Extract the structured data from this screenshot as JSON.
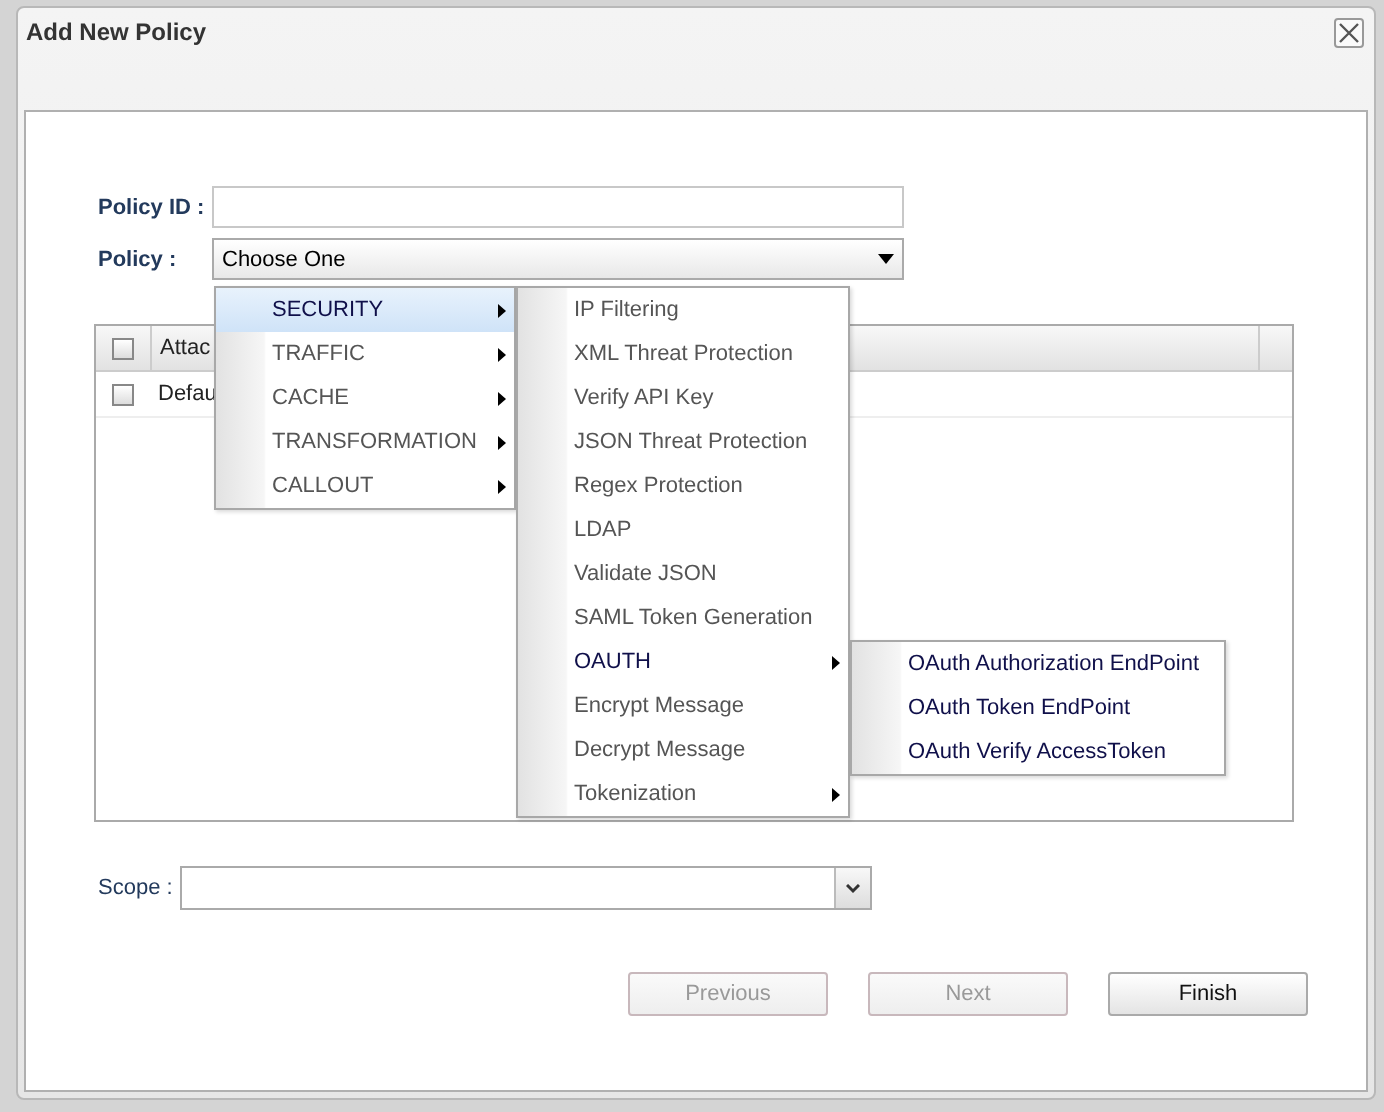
{
  "window": {
    "title": "Add New Policy"
  },
  "form": {
    "policy_id": {
      "label": "Policy ID :"
    },
    "policy": {
      "label": "Policy :",
      "value": "Choose One"
    }
  },
  "table": {
    "header_checked": false,
    "columns": [
      "Attac"
    ],
    "rows": [
      {
        "checked": false,
        "cell": "Defau"
      }
    ]
  },
  "menus": [
    {
      "items": [
        {
          "label": "SECURITY",
          "kind": "submenu",
          "selected": true,
          "open": true
        },
        {
          "label": "TRAFFIC",
          "kind": "submenu",
          "selected": false,
          "open": false
        },
        {
          "label": "CACHE",
          "kind": "submenu",
          "selected": false,
          "open": false
        },
        {
          "label": "TRANSFORMATION",
          "kind": "submenu",
          "selected": false,
          "open": false
        },
        {
          "label": "CALLOUT",
          "kind": "submenu",
          "selected": false,
          "open": false
        }
      ]
    },
    {
      "items": [
        {
          "label": "IP Filtering",
          "kind": "item",
          "selected": false,
          "open": false
        },
        {
          "label": "XML Threat Protection",
          "kind": "item",
          "selected": false,
          "open": false
        },
        {
          "label": "Verify API Key",
          "kind": "item",
          "selected": false,
          "open": false
        },
        {
          "label": "JSON Threat Protection",
          "kind": "item",
          "selected": false,
          "open": false
        },
        {
          "label": "Regex Protection",
          "kind": "item",
          "selected": false,
          "open": false
        },
        {
          "label": "LDAP",
          "kind": "item",
          "selected": false,
          "open": false
        },
        {
          "label": "Validate JSON",
          "kind": "item",
          "selected": false,
          "open": false
        },
        {
          "label": "SAML Token Generation",
          "kind": "item",
          "selected": false,
          "open": false
        },
        {
          "label": "OAUTH",
          "kind": "submenu",
          "selected": false,
          "open": true
        },
        {
          "label": "Encrypt Message",
          "kind": "item",
          "selected": false,
          "open": false
        },
        {
          "label": "Decrypt Message",
          "kind": "item",
          "selected": false,
          "open": false
        },
        {
          "label": "Tokenization",
          "kind": "submenu",
          "selected": false,
          "open": false
        }
      ]
    },
    {
      "items": [
        {
          "label": "OAuth Authorization EndPoint",
          "kind": "item",
          "selected": false,
          "open": true
        },
        {
          "label": "OAuth Token EndPoint",
          "kind": "item",
          "selected": false,
          "open": true
        },
        {
          "label": "OAuth Verify AccessToken",
          "kind": "item",
          "selected": false,
          "open": true
        }
      ]
    }
  ],
  "scope": {
    "label": "Scope :"
  },
  "buttons": [
    {
      "label": "Previous",
      "disabled": true
    },
    {
      "label": "Next",
      "disabled": true
    },
    {
      "label": "Finish",
      "disabled": false
    }
  ]
}
